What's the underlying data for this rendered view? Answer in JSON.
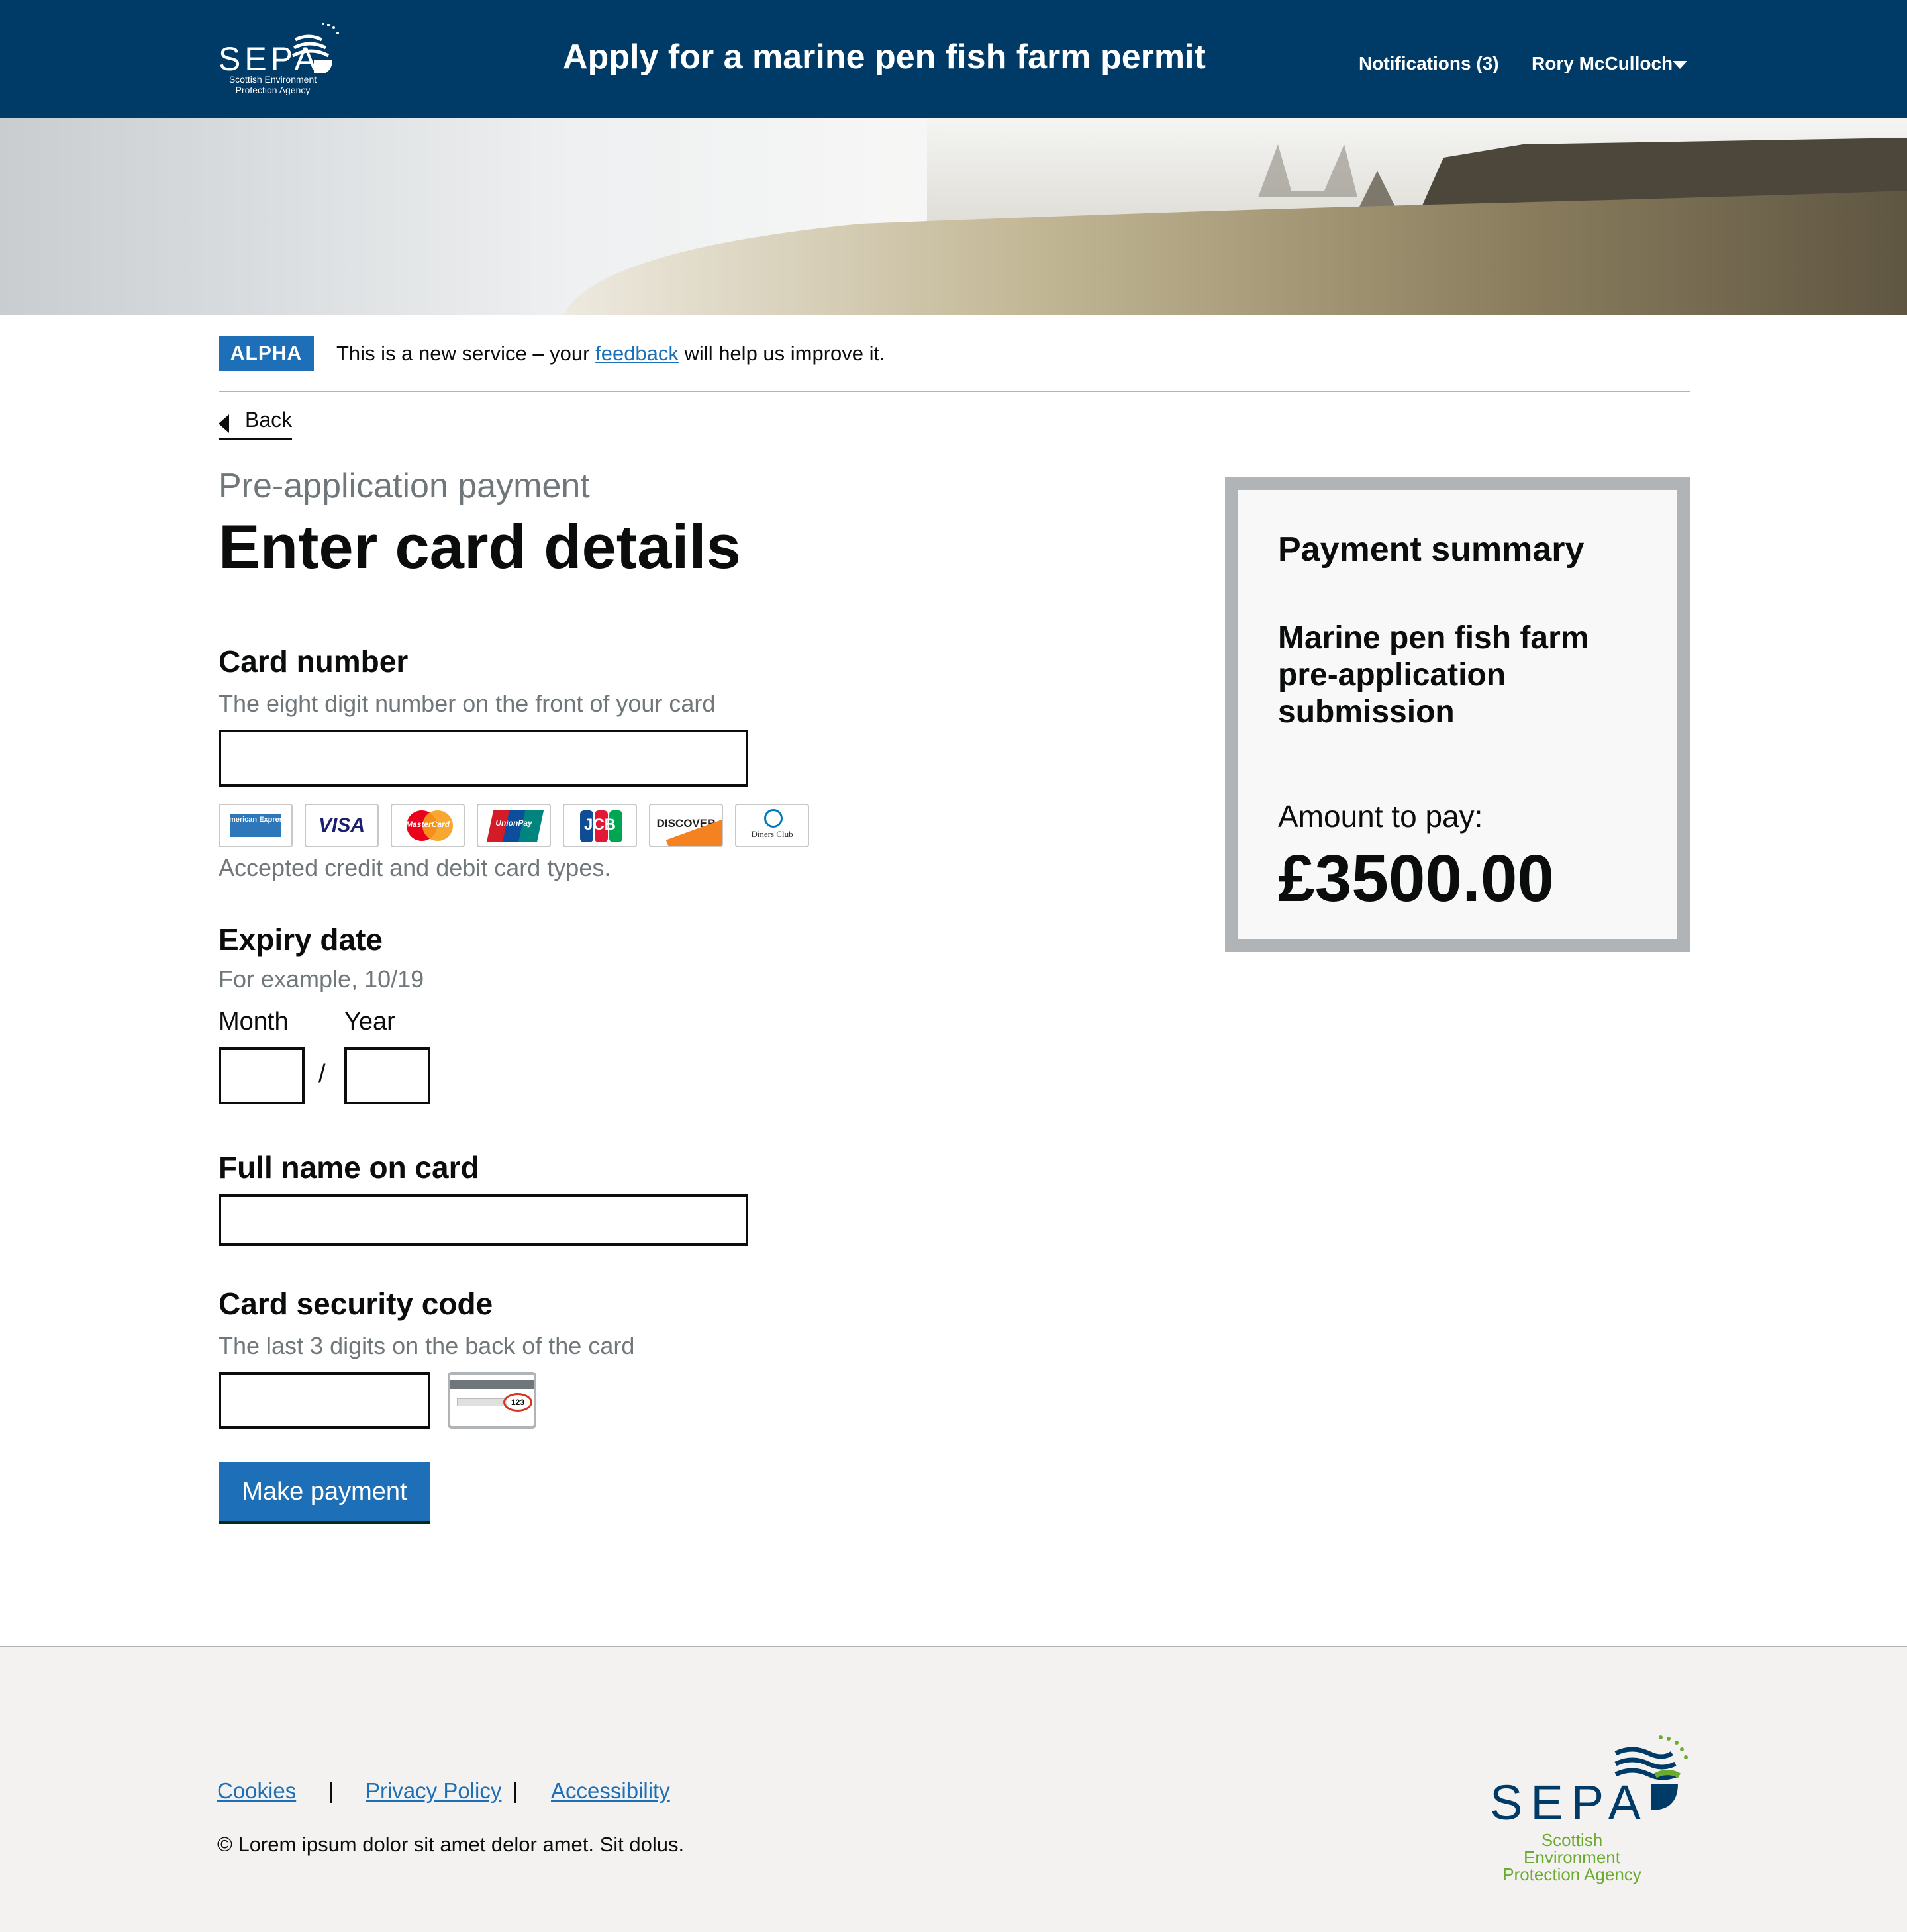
{
  "header": {
    "logo_text": "SEPA",
    "logo_subtitle_line1": "Scottish Environment",
    "logo_subtitle_line2": "Protection Agency",
    "service_title": "Apply for a marine pen fish farm permit",
    "notifications": "Notifications (3)",
    "user_name": "Rory McCulloch"
  },
  "phase_banner": {
    "tag": "ALPHA",
    "text_before": "This is a new service – your ",
    "link": "feedback",
    "text_after": " will help us improve it."
  },
  "back_link": "Back",
  "caption": "Pre-application payment",
  "title": "Enter card details",
  "form": {
    "card_number": {
      "label": "Card number",
      "hint": "The eight digit number on the front of your card",
      "value": ""
    },
    "card_types": [
      "American Express",
      "VISA",
      "MasterCard",
      "UnionPay",
      "JCB",
      "DISCOVER",
      "Diners Club"
    ],
    "card_types_hint": "Accepted credit and debit card types.",
    "expiry": {
      "label": "Expiry date",
      "hint": "For example, 10/19",
      "month_label": "Month",
      "year_label": "Year",
      "separator": "/",
      "month_value": "",
      "year_value": ""
    },
    "full_name": {
      "label": "Full name on card",
      "value": ""
    },
    "security_code": {
      "label": "Card security code",
      "hint": "The last 3 digits on the back of the card",
      "value": "",
      "example_code": "123"
    },
    "submit_label": "Make payment"
  },
  "summary": {
    "title": "Payment summary",
    "item": "Marine pen fish farm pre-application submission",
    "amount_label": "Amount to pay:",
    "amount": "£3500.00"
  },
  "footer": {
    "links": [
      "Cookies",
      "Privacy Policy",
      "Accessibility"
    ],
    "separator": "|",
    "copyright": "© Lorem ipsum dolor sit amet delor amet. Sit dolus.",
    "logo_text": "SEPA",
    "logo_subtitle_line1": "Scottish Environment",
    "logo_subtitle_line2": "Protection Agency"
  },
  "colors": {
    "header_bg": "#003a67",
    "link": "#1d70b8",
    "button": "#1d70b8",
    "footer_logo_green": "#6bab2f"
  }
}
